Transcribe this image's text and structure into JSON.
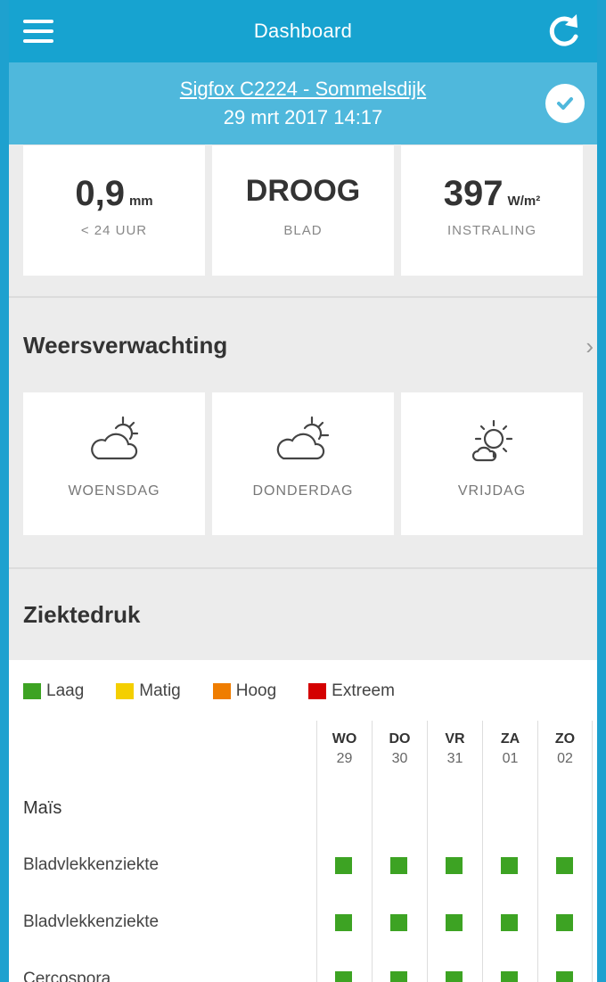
{
  "header": {
    "title": "Dashboard"
  },
  "station": {
    "name": "Sigfox C2224 - Sommelsdijk",
    "datetime": "29 mrt 2017 14:17"
  },
  "stats": [
    {
      "value": "0,9",
      "unit": "mm",
      "label": "< 24 UUR"
    },
    {
      "value": "DROOG",
      "unit": "",
      "label": "BLAD"
    },
    {
      "value": "397",
      "unit": "W/m²",
      "label": "INSTRALING"
    }
  ],
  "forecast": {
    "title": "Weersverwachting",
    "days": [
      {
        "day": "WOENSDAG",
        "icon": "cloud-sun-icon"
      },
      {
        "day": "DONDERDAG",
        "icon": "cloud-sun-icon"
      },
      {
        "day": "VRIJDAG",
        "icon": "sun-cloud-icon"
      }
    ]
  },
  "disease": {
    "title": "Ziektedruk",
    "legend": [
      {
        "label": "Laag",
        "color": "#3da323"
      },
      {
        "label": "Matig",
        "color": "#f4cf00"
      },
      {
        "label": "Hoog",
        "color": "#ef7d00"
      },
      {
        "label": "Extreem",
        "color": "#d40000"
      }
    ],
    "columns": [
      {
        "day": "WO",
        "date": "29"
      },
      {
        "day": "DO",
        "date": "30"
      },
      {
        "day": "VR",
        "date": "31"
      },
      {
        "day": "ZA",
        "date": "01"
      },
      {
        "day": "ZO",
        "date": "02"
      }
    ],
    "crop": "Maïs",
    "rows": [
      {
        "name": "Bladvlekkenziekte",
        "levels": [
          "Laag",
          "Laag",
          "Laag",
          "Laag",
          "Laag"
        ]
      },
      {
        "name": "Bladvlekkenziekte",
        "levels": [
          "Laag",
          "Laag",
          "Laag",
          "Laag",
          "Laag"
        ]
      },
      {
        "name": "Cercospora",
        "levels": [
          "Laag",
          "Laag",
          "Laag",
          "Laag",
          "Laag"
        ]
      }
    ]
  }
}
